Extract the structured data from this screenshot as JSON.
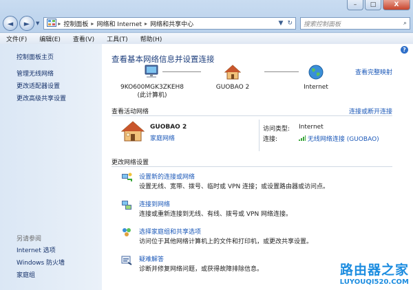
{
  "window": {
    "minimize": "–",
    "maximize": "□",
    "close": "X"
  },
  "nav": {
    "back": "◄",
    "forward": "►",
    "breadcrumb": [
      "控制面板",
      "网络和 Internet",
      "网络和共享中心"
    ],
    "refresh": "↻",
    "search_placeholder": "搜索控制面板"
  },
  "menu": [
    "文件(F)",
    "编辑(E)",
    "查看(V)",
    "工具(T)",
    "帮助(H)"
  ],
  "left": {
    "home": "控制面板主页",
    "links": [
      "管理无线网络",
      "更改适配器设置",
      "更改高级共享设置"
    ],
    "see_also_title": "另请参阅",
    "see_also": [
      "Internet 选项",
      "Windows 防火墙",
      "家庭组"
    ]
  },
  "main": {
    "help": "?",
    "title": "查看基本网络信息并设置连接",
    "full_map": "查看完整映射",
    "computer_name": "9KO600MGK3ZKEH8",
    "computer_sub": "(此计算机)",
    "router_name": "GUOBAO  2",
    "internet_name": "Internet",
    "active_title": "查看活动网络",
    "connect_link": "连接或断开连接",
    "network_name": "GUOBAO  2",
    "network_type": "家庭网络",
    "access_type_label": "访问类型:",
    "access_type_value": "Internet",
    "connection_label": "连接:",
    "connection_value": "无线网络连接 (GUOBAO)",
    "change_title": "更改网络设置",
    "tasks": [
      {
        "title": "设置新的连接或网络",
        "desc": "设置无线、宽带、拨号、临时或 VPN 连接；或设置路由器或访问点。"
      },
      {
        "title": "连接到网络",
        "desc": "连接或重新连接到无线、有线、拨号或 VPN 网络连接。"
      },
      {
        "title": "选择家庭组和共享选项",
        "desc": "访问位于其他网络计算机上的文件和打印机，或更改共享设置。"
      },
      {
        "title": "疑难解答",
        "desc": "诊断并修复网络问题，或获得故障排除信息。"
      }
    ]
  },
  "watermark": {
    "line1": "路由器之家",
    "line2": "LUYOUQI520.COM"
  }
}
